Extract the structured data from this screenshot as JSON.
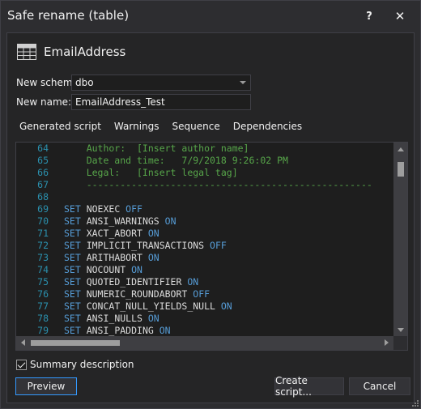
{
  "window": {
    "title": "Safe rename (table)",
    "help_label": "?",
    "close_label": "✕"
  },
  "object": {
    "name": "EmailAddress",
    "icon": "table-icon"
  },
  "form": {
    "schema_label": "New schema:",
    "schema_value": "dbo",
    "name_label": "New name:",
    "name_value": "EmailAddress_Test"
  },
  "tabs": [
    {
      "label": "Generated script"
    },
    {
      "label": "Warnings"
    },
    {
      "label": "Sequence"
    },
    {
      "label": "Dependencies"
    }
  ],
  "script_lines": [
    {
      "n": "64",
      "parts": [
        {
          "t": "    Author:  [Insert author name]",
          "c": "cm"
        }
      ]
    },
    {
      "n": "65",
      "parts": [
        {
          "t": "    Date and time:   7/9/2018 9:26:02 PM",
          "c": "cm"
        }
      ]
    },
    {
      "n": "66",
      "parts": [
        {
          "t": "    Legal:   [Insert legal tag]",
          "c": "cm"
        }
      ]
    },
    {
      "n": "67",
      "parts": [
        {
          "t": "    ---------------------------------------------------",
          "c": "cm"
        }
      ]
    },
    {
      "n": "68",
      "parts": []
    },
    {
      "n": "69",
      "parts": [
        {
          "t": "SET",
          "c": "kw"
        },
        {
          "t": " NOEXEC ",
          "c": "id"
        },
        {
          "t": "OFF",
          "c": "kw"
        }
      ]
    },
    {
      "n": "70",
      "parts": [
        {
          "t": "SET",
          "c": "kw"
        },
        {
          "t": " ANSI_WARNINGS ",
          "c": "id"
        },
        {
          "t": "ON",
          "c": "kw"
        }
      ]
    },
    {
      "n": "71",
      "parts": [
        {
          "t": "SET",
          "c": "kw"
        },
        {
          "t": " XACT_ABORT ",
          "c": "id"
        },
        {
          "t": "ON",
          "c": "kw"
        }
      ]
    },
    {
      "n": "72",
      "parts": [
        {
          "t": "SET",
          "c": "kw"
        },
        {
          "t": " IMPLICIT_TRANSACTIONS ",
          "c": "id"
        },
        {
          "t": "OFF",
          "c": "kw"
        }
      ]
    },
    {
      "n": "73",
      "parts": [
        {
          "t": "SET",
          "c": "kw"
        },
        {
          "t": " ARITHABORT ",
          "c": "id"
        },
        {
          "t": "ON",
          "c": "kw"
        }
      ]
    },
    {
      "n": "74",
      "parts": [
        {
          "t": "SET",
          "c": "kw"
        },
        {
          "t": " NOCOUNT ",
          "c": "id"
        },
        {
          "t": "ON",
          "c": "kw"
        }
      ]
    },
    {
      "n": "75",
      "parts": [
        {
          "t": "SET",
          "c": "kw"
        },
        {
          "t": " QUOTED_IDENTIFIER ",
          "c": "id"
        },
        {
          "t": "ON",
          "c": "kw"
        }
      ]
    },
    {
      "n": "76",
      "parts": [
        {
          "t": "SET",
          "c": "kw"
        },
        {
          "t": " NUMERIC_ROUNDABORT ",
          "c": "id"
        },
        {
          "t": "OFF",
          "c": "kw"
        }
      ]
    },
    {
      "n": "77",
      "parts": [
        {
          "t": "SET",
          "c": "kw"
        },
        {
          "t": " CONCAT_NULL_YIELDS_NULL ",
          "c": "id"
        },
        {
          "t": "ON",
          "c": "kw"
        }
      ]
    },
    {
      "n": "78",
      "parts": [
        {
          "t": "SET",
          "c": "kw"
        },
        {
          "t": " ANSI_NULLS ",
          "c": "id"
        },
        {
          "t": "ON",
          "c": "kw"
        }
      ]
    },
    {
      "n": "79",
      "parts": [
        {
          "t": "SET",
          "c": "kw"
        },
        {
          "t": " ANSI_PADDING ",
          "c": "id"
        },
        {
          "t": "ON",
          "c": "kw"
        }
      ]
    }
  ],
  "summary": {
    "label": "Summary description",
    "checked": true
  },
  "buttons": {
    "preview": "Preview",
    "create_script": "Create script...",
    "cancel": "Cancel"
  },
  "colors": {
    "background": "#2d2d30",
    "panel": "#252526",
    "editor": "#1e1e1e",
    "keyword": "#569cd6",
    "comment": "#57a64a",
    "line_number": "#2b91af",
    "focus": "#3399ff"
  }
}
